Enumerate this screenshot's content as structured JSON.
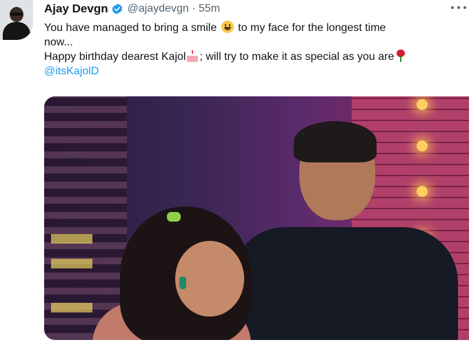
{
  "tweet": {
    "author_name": "Ajay Devgn",
    "handle_time": "@ajaydevgn · 55m",
    "text_line_1a": "You have managed to bring a smile ",
    "text_line_1b": " to my face for the longest time",
    "text_line_2": "now...",
    "text_line_3a": "Happy birthday dearest Kajol",
    "text_line_3b": "; will try to make it as special as you are",
    "mention": "@itsKajolD"
  },
  "icons": {
    "verified": "verified-badge-icon",
    "more": "more-options-icon",
    "smile_emoji": "smiling-face-emoji",
    "cake_emoji": "birthday-cake-emoji",
    "rose_emoji": "rose-emoji"
  },
  "colors": {
    "accent": "#1d9bf0",
    "text": "#0f1419",
    "secondary": "#536471"
  }
}
